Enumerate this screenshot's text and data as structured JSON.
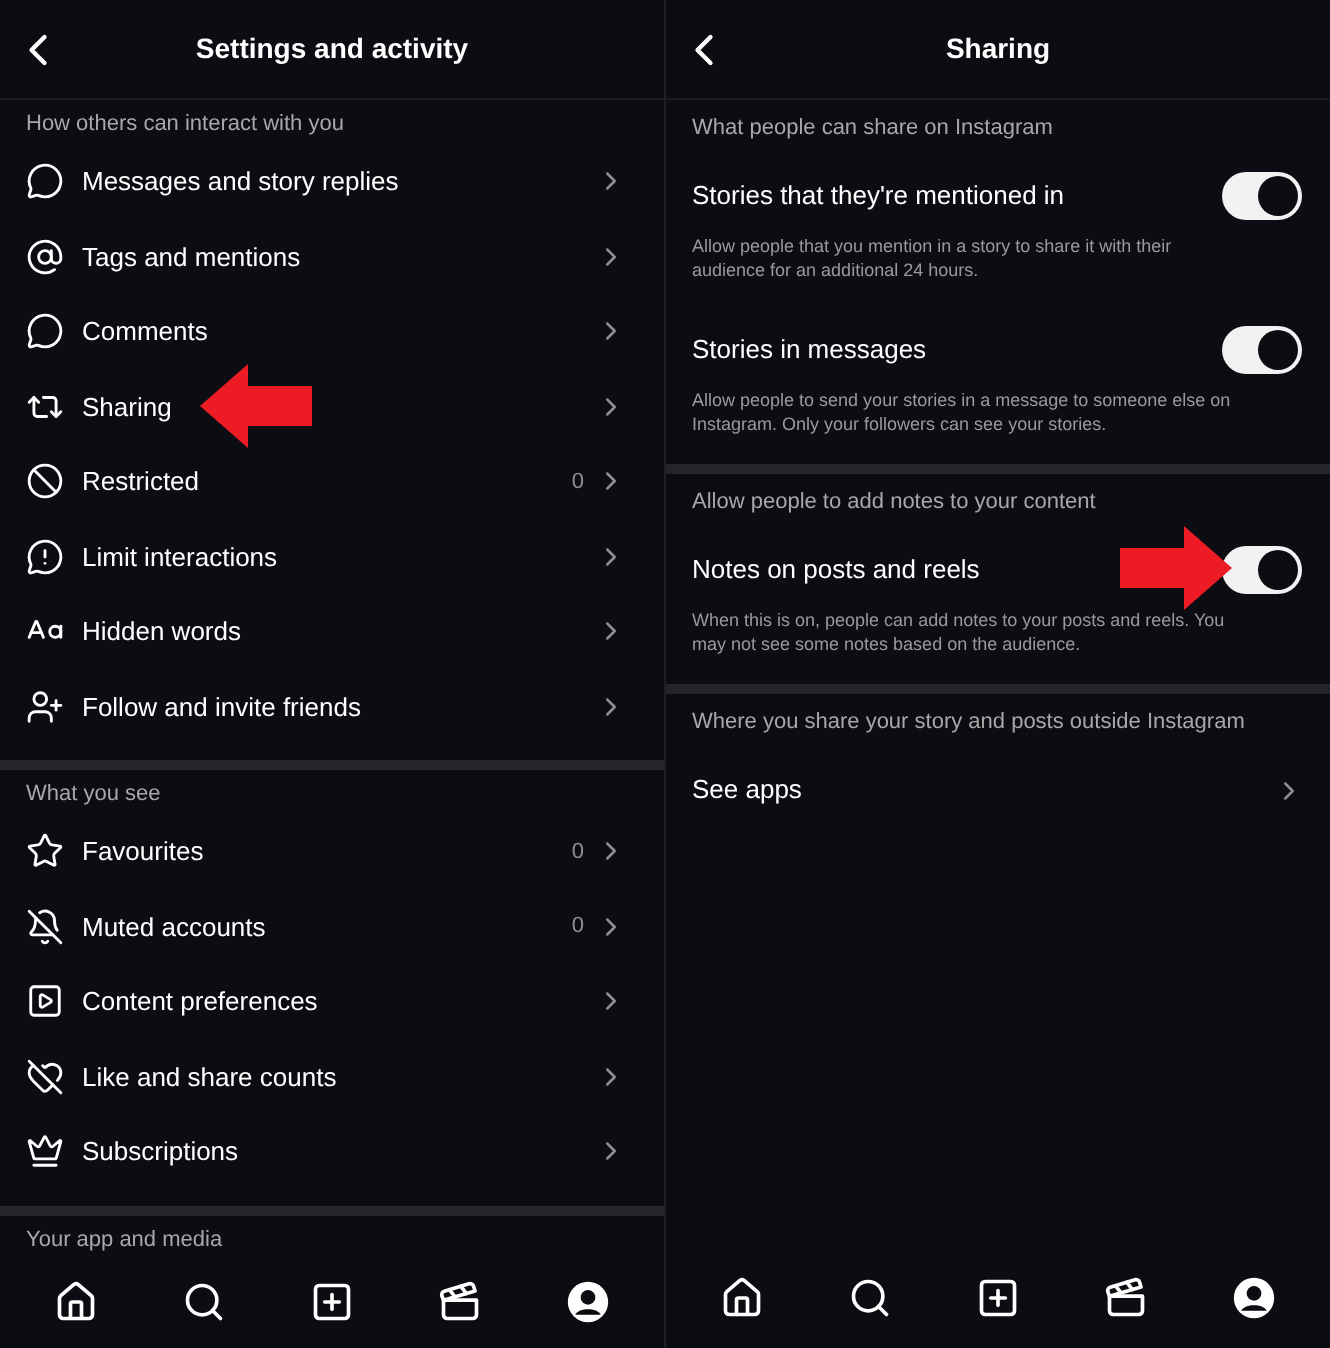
{
  "settings_screen": {
    "title": "Settings and activity",
    "sections": [
      {
        "heading": "How others can interact with you",
        "items": [
          {
            "label": "Messages and story replies",
            "highlighted": false
          },
          {
            "label": "Tags and mentions",
            "highlighted": false
          },
          {
            "label": "Comments",
            "highlighted": false
          },
          {
            "label": "Sharing",
            "highlighted": true
          },
          {
            "label": "Restricted",
            "count": "0",
            "highlighted": false
          },
          {
            "label": "Limit interactions",
            "highlighted": false
          },
          {
            "label": "Hidden words",
            "highlighted": false
          },
          {
            "label": "Follow and invite friends",
            "highlighted": false
          }
        ]
      },
      {
        "heading": "What you see",
        "items": [
          {
            "label": "Favourites",
            "count": "0",
            "highlighted": false
          },
          {
            "label": "Muted accounts",
            "count": "0",
            "highlighted": false
          },
          {
            "label": "Content preferences",
            "highlighted": false
          },
          {
            "label": "Like and share counts",
            "highlighted": false
          },
          {
            "label": "Subscriptions",
            "highlighted": false
          }
        ]
      },
      {
        "heading": "Your app and media"
      }
    ],
    "nav": [
      {
        "selected": false
      },
      {
        "selected": false
      },
      {
        "selected": false
      },
      {
        "selected": false
      },
      {
        "selected": true
      }
    ]
  },
  "sharing_screen": {
    "title": "Sharing",
    "sections": [
      {
        "heading": "What people can share on Instagram",
        "items": [
          {
            "kind": "toggle",
            "label": "Stories that they're mentioned in",
            "on": true,
            "highlighted": false,
            "description": "Allow people that you mention in a story to share it with their audience for an additional 24 hours."
          },
          {
            "kind": "toggle",
            "label": "Stories in messages",
            "on": true,
            "highlighted": false,
            "description": "Allow people to send your stories in a message to someone else on Instagram. Only your followers can see your stories."
          }
        ]
      },
      {
        "heading": "Allow people to add notes to your content",
        "items": [
          {
            "kind": "toggle",
            "label": "Notes on posts and reels",
            "on": true,
            "highlighted": true,
            "description": "When this is on, people can add notes to your posts and reels. You may not see some notes based on the audience."
          }
        ]
      },
      {
        "heading": "Where you share your story and posts outside Instagram",
        "items": [
          {
            "kind": "link",
            "label": "See apps",
            "highlighted": false
          }
        ]
      }
    ],
    "nav": [
      {
        "selected": false
      },
      {
        "selected": false
      },
      {
        "selected": false
      },
      {
        "selected": false
      },
      {
        "selected": true
      }
    ]
  }
}
